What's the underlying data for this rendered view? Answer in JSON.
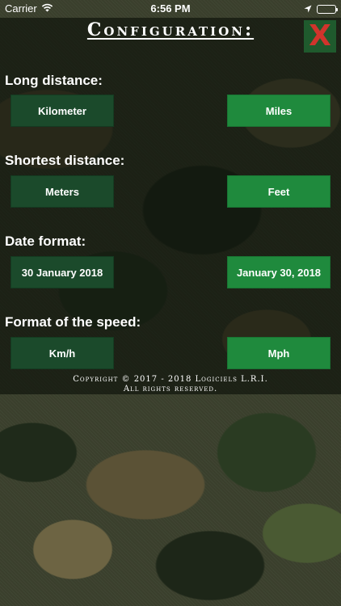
{
  "status_bar": {
    "carrier": "Carrier",
    "time": "6:56 PM"
  },
  "header": {
    "title": "Configuration:",
    "close_label": "X"
  },
  "sections": [
    {
      "label": "Long distance:",
      "options": [
        "Kilometer",
        "Miles"
      ]
    },
    {
      "label": "Shortest distance:",
      "options": [
        "Meters",
        "Feet"
      ]
    },
    {
      "label": "Date format:",
      "options": [
        "30 January 2018",
        "January 30, 2018"
      ]
    },
    {
      "label": "Format of the speed:",
      "options": [
        "Km/h",
        "Mph"
      ]
    }
  ],
  "footer": {
    "copyright_line1": "Copyright © 2017 - 2018 Logiciels L.R.I.",
    "copyright_line2": "All rights reserved."
  },
  "colors": {
    "selected_option": "#1b4a2b",
    "unselected_option": "#1f8a3d",
    "close_button_bg": "#1f5a2d",
    "close_x": "#d0342c"
  },
  "icons": [
    "wifi-icon",
    "location-arrow-icon",
    "battery-icon",
    "close-icon"
  ]
}
